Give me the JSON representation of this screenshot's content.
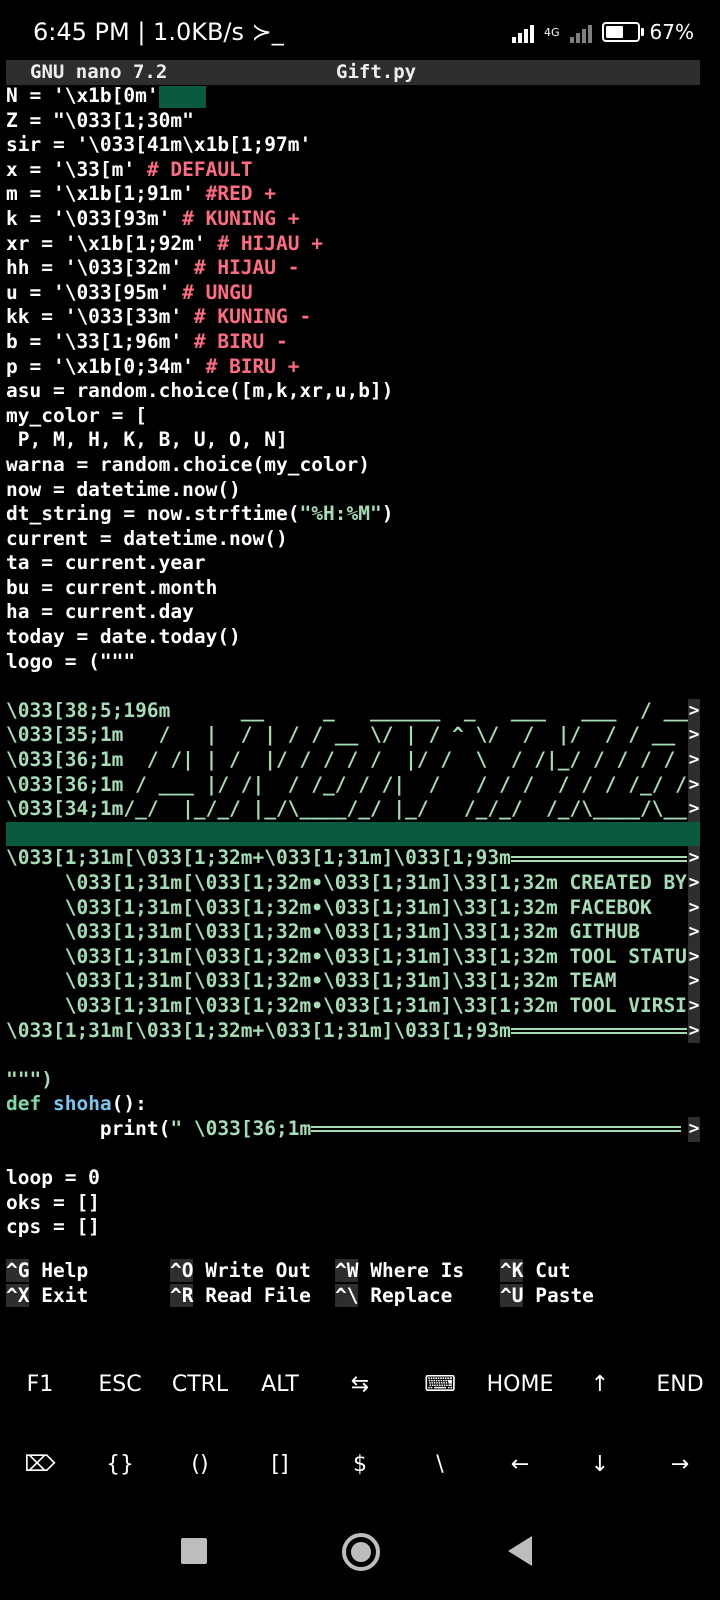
{
  "status_bar": {
    "time_speed": "6:45 PM | 1.0KB/s ≻_",
    "network_type": "4G",
    "battery": "67%",
    "battery_level": 0.67
  },
  "nano": {
    "version": "GNU nano 7.2",
    "filename": "Gift.py"
  },
  "code": {
    "l1": "N = '\\x1b[0m'",
    "l2": "Z = \"\\033[1;30m\"",
    "l3": "sir = '\\033[41m\\x1b[1;97m'",
    "l4a": "x = '\\33[m'",
    "l4b": " # DEFAULT",
    "l5a": "m = '\\x1b[1;91m'",
    "l5b": " #RED +",
    "l6a": "k = '\\033[93m'",
    "l6b": " # KUNING +",
    "l7a": "xr = '\\x1b[1;92m'",
    "l7b": " # HIJAU +",
    "l8a": "hh = '\\033[32m'",
    "l8b": " # HIJAU -",
    "l9a": "u = '\\033[95m'",
    "l9b": " # UNGU",
    "l10a": "kk = '\\033[33m'",
    "l10b": " # KUNING -",
    "l11a": "b = '\\33[1;96m'",
    "l11b": " # BIRU -",
    "l12a": "p = '\\x1b[0;34m'",
    "l12b": " # BIRU +",
    "l13": "asu = random.choice([m,k,xr,u,b])",
    "l14": "my_color = [",
    "l15": " P, M, H, K, B, U, O, N]",
    "l16": "warna = random.choice(my_color)",
    "l17": "now = datetime.now()",
    "l18a": "dt_string = now.strftime(",
    "l18b": "\"%H:%M\"",
    "l18c": ")",
    "l19": "current = datetime.now()",
    "l20": "ta = current.year",
    "l21": "bu = current.month",
    "l22": "ha = current.day",
    "l23": "today = date.today()",
    "l24": "logo = (\"\"\"",
    "art1": "\\033[38;5;196m      __     _   ______  _   ___   ___  / _____",
    "art2": "\\033[35;1m   /   |  / | / / __ \\/ | / ^ \\/  /  |/  / / __ \\/",
    "art3": "\\033[36;1m  / /| | /  |/ / / / /  |/ /  \\  / /|_/ / / / /",
    "art4": "\\033[36;1m / ___ |/ /|  / /_/ / /|  /   / / /  / / / /_/ /",
    "art5": "\\033[34;1m/_/  |_/_/ |_/\\____/_/ |_/   /_/_/  /_/\\____/\\__",
    "b1": "\\033[1;31m[\\033[1;32m+\\033[1;31m]\\033[1;93m",
    "m1": "     \\033[1;31m[\\033[1;32m•\\033[1;31m]\\33[1;32m CREATED BY",
    "m2": "     \\033[1;31m[\\033[1;32m•\\033[1;31m]\\33[1;32m FACEBOK",
    "m3": "     \\033[1;31m[\\033[1;32m•\\033[1;31m]\\33[1;32m GITHUB",
    "m4": "     \\033[1;31m[\\033[1;32m•\\033[1;31m]\\33[1;32m TOOL STATU",
    "m5": "     \\033[1;31m[\\033[1;32m•\\033[1;31m]\\33[1;32m TEAM",
    "m6": "     \\033[1;31m[\\033[1;32m•\\033[1;31m]\\33[1;32m TOOL VIRSI",
    "b2": "\\033[1;31m[\\033[1;32m+\\033[1;31m]\\033[1;93m",
    "close": "\"\"\")",
    "def_kw": "def ",
    "def_name": "shoha",
    "def_rest": "():",
    "print_a": "        print(",
    "print_b": "\" \\033[36;1m",
    "loop": "loop = 0",
    "oks": "oks = []",
    "cps": "cps = []",
    "overflow_marker": ">"
  },
  "shortcuts": [
    {
      "key": "^G",
      "label": " Help"
    },
    {
      "key": "^O",
      "label": " Write Out"
    },
    {
      "key": "^W",
      "label": " Where Is"
    },
    {
      "key": "^K",
      "label": " Cut"
    },
    {
      "key": "^X",
      "label": " Exit"
    },
    {
      "key": "^R",
      "label": " Read File"
    },
    {
      "key": "^\\",
      "label": " Replace"
    },
    {
      "key": "^U",
      "label": " Paste"
    }
  ],
  "extra_keys_row1": [
    "F1",
    "ESC",
    "CTRL",
    "ALT",
    "⇆",
    "⌨",
    "HOME",
    "↑",
    "END"
  ],
  "extra_keys_row2": [
    "⌦",
    "{}",
    "()",
    "[]",
    "$",
    "\\",
    "←",
    "↓",
    "→"
  ]
}
